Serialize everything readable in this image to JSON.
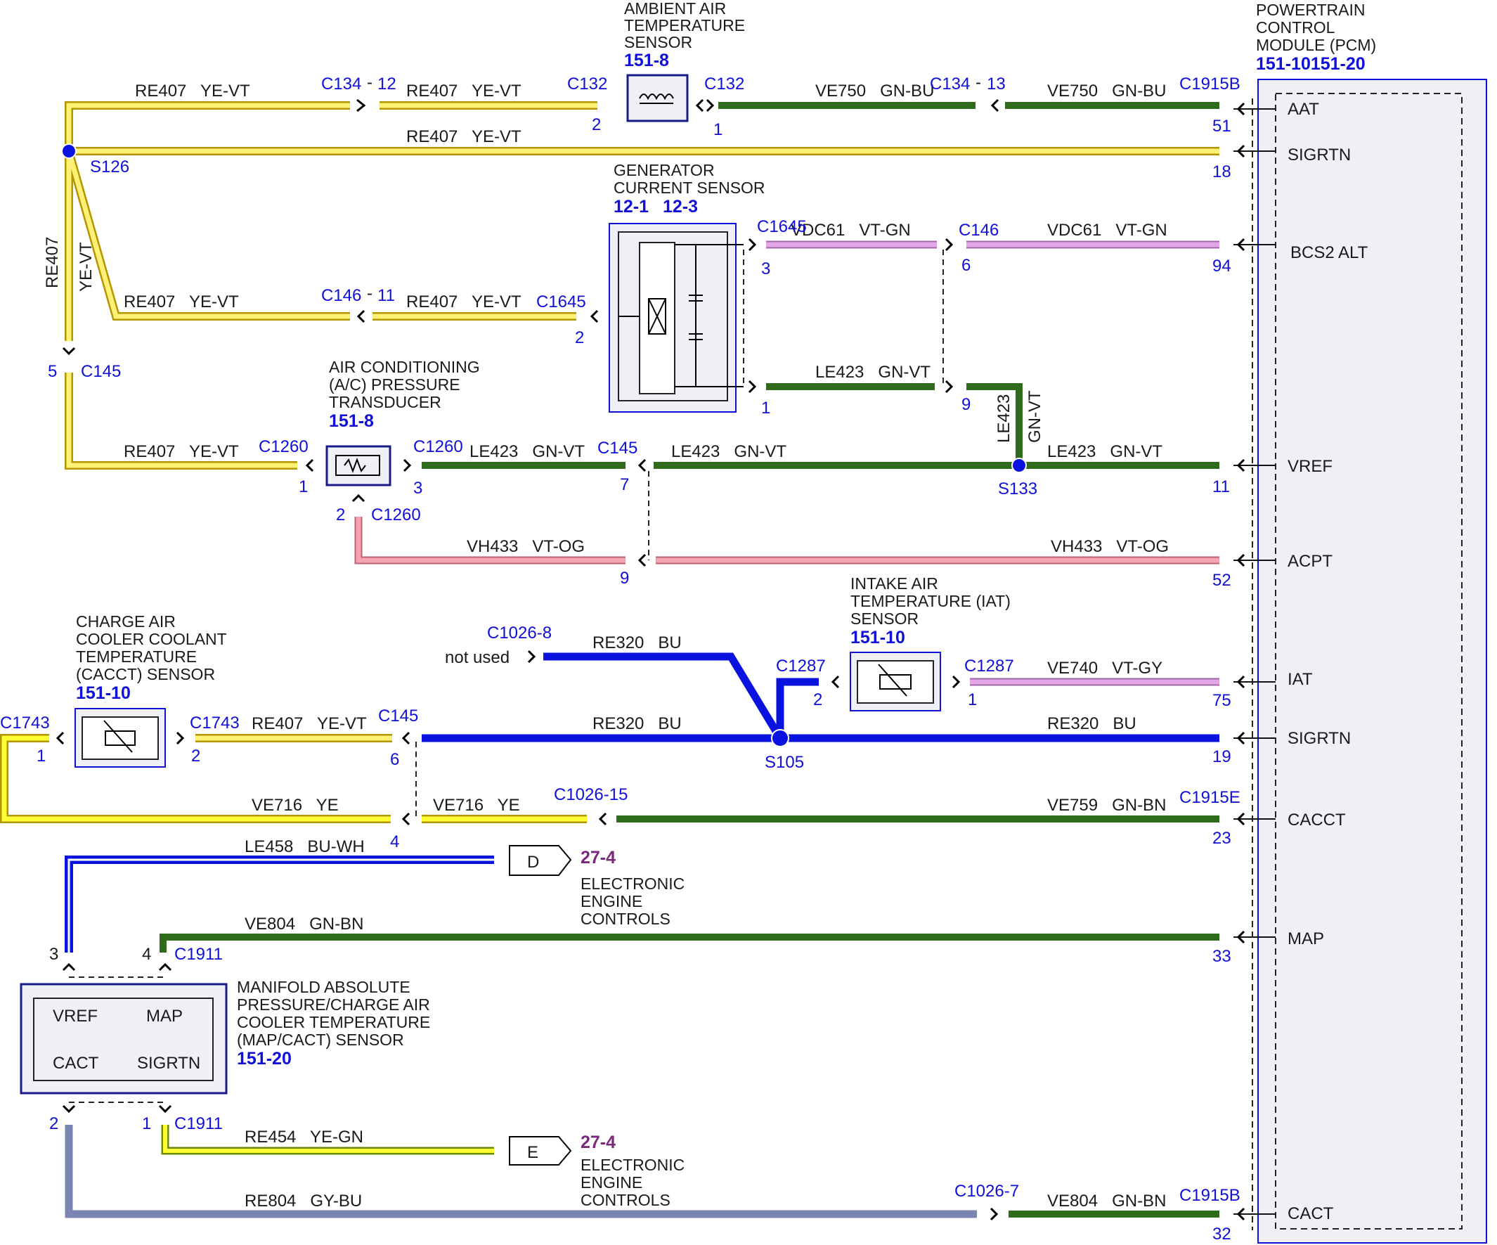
{
  "pcm": {
    "title_lines": [
      "POWERTRAIN",
      "CONTROL",
      "MODULE (PCM)"
    ],
    "ref": "151-10151-20",
    "pins": [
      "AAT",
      "SIGRTN",
      "BCS2 ALT",
      "VREF",
      "ACPT",
      "IAT",
      "SIGRTN",
      "CACCT",
      "MAP",
      "CACT"
    ]
  },
  "components": {
    "aat": {
      "lines": [
        "AMBIENT AIR",
        "TEMPERATURE",
        "SENSOR"
      ],
      "ref": "151-8"
    },
    "gcs": {
      "lines": [
        "GENERATOR",
        "CURRENT SENSOR"
      ],
      "ref1": "12-1",
      "ref2": "12-3"
    },
    "ac": {
      "lines": [
        "AIR CONDITIONING",
        "(A/C) PRESSURE",
        "TRANSDUCER"
      ],
      "ref": "151-8"
    },
    "iat": {
      "lines": [
        "INTAKE AIR",
        "TEMPERATURE (IAT)",
        "SENSOR"
      ],
      "ref": "151-10"
    },
    "cacct": {
      "lines": [
        "CHARGE AIR",
        "COOLER COOLANT",
        "TEMPERATURE",
        "(CACCT) SENSOR"
      ],
      "ref": "151-10"
    },
    "map": {
      "lines": [
        "MANIFOLD ABSOLUTE",
        "PRESSURE/CHARGE AIR",
        "COOLER TEMPERATURE",
        "(MAP/CACT) SENSOR"
      ],
      "ref": "151-20",
      "pins": [
        "VREF",
        "MAP",
        "CACT",
        "SIGRTN"
      ]
    },
    "eec_d": {
      "letter": "D",
      "ref": "27-4",
      "lines": [
        "ELECTRONIC",
        "ENGINE",
        "CONTROLS"
      ]
    },
    "eec_e": {
      "letter": "E",
      "ref": "27-4",
      "lines": [
        "ELECTRONIC",
        "ENGINE",
        "CONTROLS"
      ]
    }
  },
  "wire_labels": {
    "w1a": "RE407   YE-VT",
    "w1b": "RE407   YE-VT",
    "w1c": "VE750   GN-BU",
    "w1d": "VE750   GN-BU",
    "w2": "RE407   YE-VT",
    "w3v1": "RE407",
    "w3v2": "YE-VT",
    "w4a": "VDC61   VT-GN",
    "w4b": "VDC61   VT-GN",
    "w5a": "RE407   YE-VT",
    "w5b": "RE407   YE-VT",
    "w6": "LE423   GN-VT",
    "w6v1": "LE423",
    "w6v2": "GN-VT",
    "w7a": "RE407   YE-VT",
    "w7b": "LE423   GN-VT",
    "w7c": "LE423   GN-VT",
    "w7d": "LE423   GN-VT",
    "w8a": "VH433   VT-OG",
    "w8b": "VH433   VT-OG",
    "w9a": "RE320   BU",
    "w9b": "VE740   VT-GY",
    "w10a": "RE407   YE-VT",
    "w10b": "RE320   BU",
    "w10c": "RE320   BU",
    "w11a": "VE716   YE",
    "w11b": "VE716   YE",
    "w11c": "VE759   GN-BN",
    "w12": "LE458   BU-WH",
    "w13": "VE804   GN-BN",
    "w14": "RE454   YE-GN",
    "w15a": "RE804   GY-BU",
    "w15b": "VE804   GN-BN",
    "not_used": "not used"
  },
  "connectors": {
    "c1": "C134",
    "c1n": "12",
    "c2": "C132",
    "c3": "C132",
    "c4": "C134",
    "c4n": "13",
    "c5": "C1915B",
    "c6": "C1645",
    "c7": "C146",
    "c8": "C146",
    "c8n": "11",
    "c9": "C1645",
    "c10": "C145",
    "c11": "C1260",
    "c12": "C1260",
    "c13": "C145",
    "c14": "C1260",
    "c15": "C1026-8",
    "c16": "C1287",
    "c17": "C1287",
    "c18": "C1743",
    "c19": "C1743",
    "c20": "C145",
    "c21": "C1026-15",
    "c22": "C1915E",
    "c23": "C1911",
    "c24": "C1911",
    "c25": "C1026-7",
    "c26": "C1915B"
  },
  "splices": {
    "s126": "S126",
    "s133": "S133",
    "s105": "S105"
  },
  "pins": {
    "p1": "2",
    "p2": "1",
    "p3": "51",
    "p4": "18",
    "p5": "3",
    "p6": "6",
    "p7": "94",
    "p8": "2",
    "p9": "5",
    "p10": "1",
    "p11": "9",
    "p12": "1",
    "p13": "3",
    "p14": "7",
    "p15": "11",
    "p16": "2",
    "p17": "9",
    "p18": "52",
    "p19": "2",
    "p20": "1",
    "p21": "75",
    "p22": "1",
    "p23": "2",
    "p24": "6",
    "p25": "19",
    "p26": "4",
    "p27": "23",
    "p28": "3",
    "p29": "4",
    "p30": "33",
    "p31": "2",
    "p32": "1",
    "p33": "32"
  },
  "colors": {
    "yellow": "#fff176",
    "yellow_edge": "#c8a400",
    "green": "#2e6b1c",
    "blue": "#0a12e0",
    "violet": "#e3a6e6",
    "pink": "#f4a3b0",
    "grey_blue": "#7b85b5",
    "connector_blue": "#1010d8"
  }
}
